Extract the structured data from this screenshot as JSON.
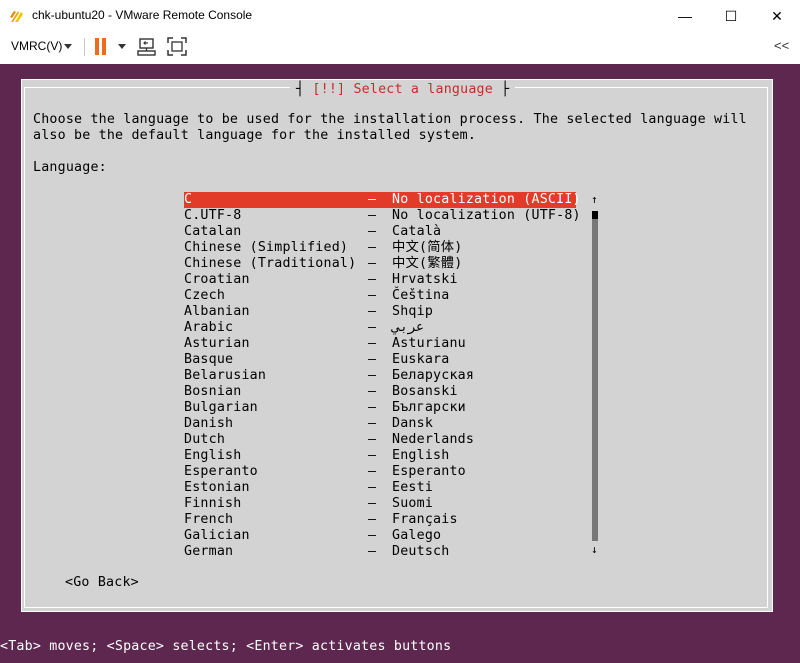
{
  "window": {
    "title": "chk-ubuntu20 - VMware Remote Console",
    "minimize_glyph": "—",
    "maximize_glyph": "☐",
    "close_glyph": "✕"
  },
  "toolbar": {
    "vmrc_label": "VMRC(V)",
    "collapse_glyph": "<<"
  },
  "dialog": {
    "title_left": "┤ ",
    "title": "[!!] Select a language",
    "title_right": " ├",
    "description_line1": "Choose the language to be used for the installation process. The selected language will",
    "description_line2": "also be the default language for the installed system.",
    "language_label": "Language:",
    "separator": "–",
    "languages": [
      {
        "name": "C",
        "local": "No localization (ASCII)",
        "selected": true
      },
      {
        "name": "C.UTF-8",
        "local": "No localization (UTF-8)"
      },
      {
        "name": "Catalan",
        "local": "Català"
      },
      {
        "name": "Chinese (Simplified)",
        "local": "中文(简体)"
      },
      {
        "name": "Chinese (Traditional)",
        "local": "中文(繁體)"
      },
      {
        "name": "Croatian",
        "local": "Hrvatski"
      },
      {
        "name": "Czech",
        "local": "Čeština"
      },
      {
        "name": "Albanian",
        "local": "Shqip"
      },
      {
        "name": "Arabic",
        "local": "عربي"
      },
      {
        "name": "Asturian",
        "local": "Asturianu"
      },
      {
        "name": "Basque",
        "local": "Euskara"
      },
      {
        "name": "Belarusian",
        "local": "Беларуская"
      },
      {
        "name": "Bosnian",
        "local": "Bosanski"
      },
      {
        "name": "Bulgarian",
        "local": "Български"
      },
      {
        "name": "Danish",
        "local": "Dansk"
      },
      {
        "name": "Dutch",
        "local": "Nederlands"
      },
      {
        "name": "English",
        "local": "English"
      },
      {
        "name": "Esperanto",
        "local": "Esperanto"
      },
      {
        "name": "Estonian",
        "local": "Eesti"
      },
      {
        "name": "Finnish",
        "local": "Suomi"
      },
      {
        "name": "French",
        "local": "Français"
      },
      {
        "name": "Galician",
        "local": "Galego"
      },
      {
        "name": "German",
        "local": "Deutsch"
      }
    ],
    "scroll_up_glyph": "↑",
    "scroll_down_glyph": "↓",
    "go_back_label": "<Go Back>"
  },
  "status_bar": {
    "text": "<Tab> moves; <Space> selects; <Enter> activates buttons"
  },
  "colors": {
    "console_bg": "#5e2750",
    "dialog_bg": "#d3d3d3",
    "selection": "#e23b2a",
    "title_red": "#c62c2c",
    "pause_orange": "#ef6a1a"
  },
  "icons": {
    "app": "vmware-logo-icon",
    "pause": "pause-icon",
    "send_keys": "send-ctrl-alt-del-icon",
    "fullscreen": "fullscreen-icon"
  }
}
